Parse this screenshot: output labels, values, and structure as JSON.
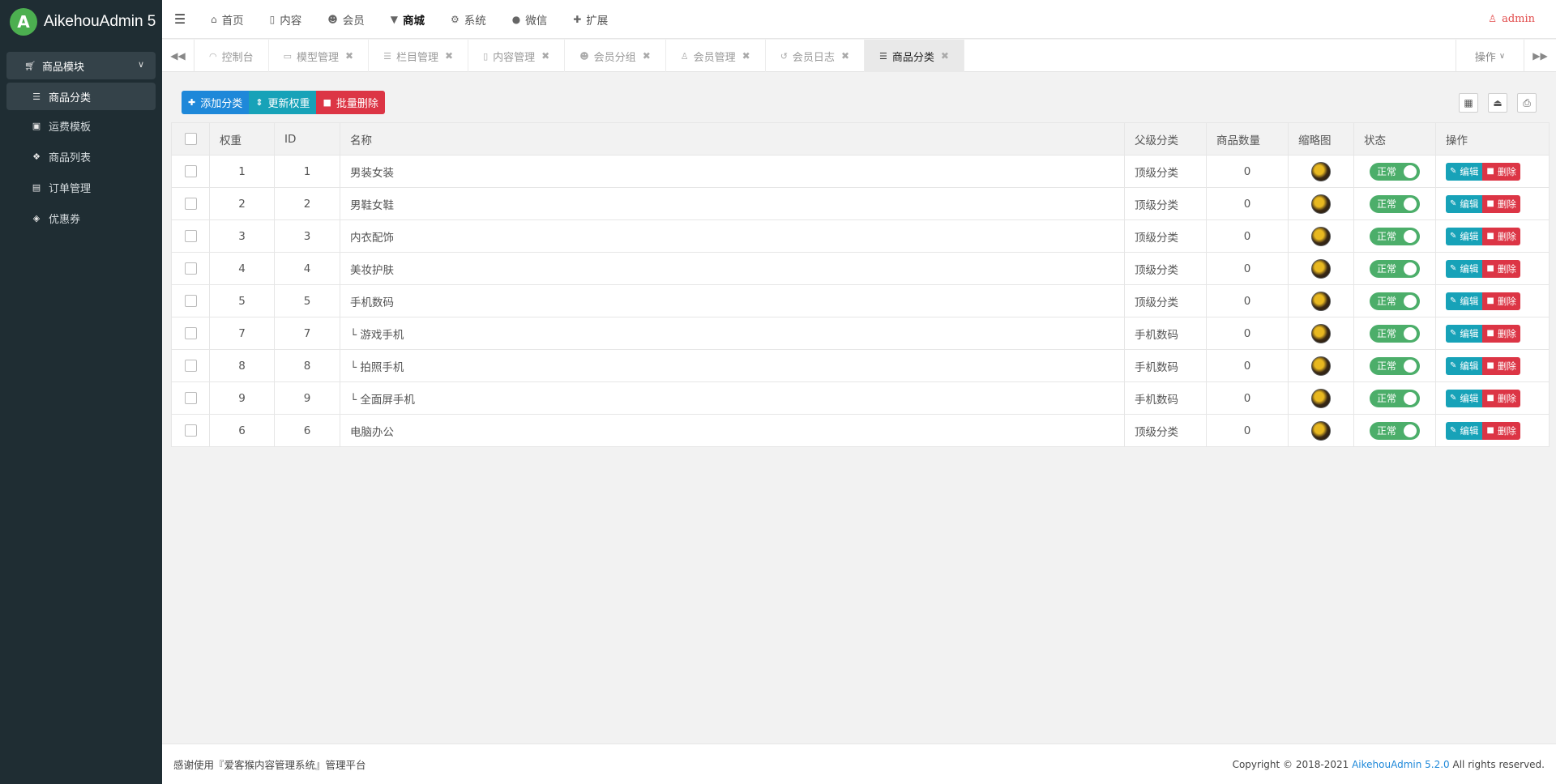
{
  "app": {
    "logo_letter": "A",
    "brand": "AikehouAdmin 5"
  },
  "sidebar": {
    "group_label": "商品模块",
    "items": [
      {
        "label": "商品分类",
        "icon": "list-icon"
      },
      {
        "label": "运费模板",
        "icon": "money-icon"
      },
      {
        "label": "商品列表",
        "icon": "gift-icon"
      },
      {
        "label": "订单管理",
        "icon": "order-icon"
      },
      {
        "label": "优惠券",
        "icon": "ticket-icon"
      }
    ]
  },
  "topnav": {
    "items": [
      {
        "label": "首页",
        "icon": "home-icon"
      },
      {
        "label": "内容",
        "icon": "file-icon"
      },
      {
        "label": "会员",
        "icon": "users-icon"
      },
      {
        "label": "商城",
        "icon": "cart-icon"
      },
      {
        "label": "系统",
        "icon": "gears-icon"
      },
      {
        "label": "微信",
        "icon": "wechat-icon"
      },
      {
        "label": "扩展",
        "icon": "plus-icon"
      }
    ],
    "user": "admin"
  },
  "tabs": {
    "items": [
      {
        "label": "控制台",
        "closable": false
      },
      {
        "label": "模型管理",
        "closable": true
      },
      {
        "label": "栏目管理",
        "closable": true
      },
      {
        "label": "内容管理",
        "closable": true
      },
      {
        "label": "会员分组",
        "closable": true
      },
      {
        "label": "会员管理",
        "closable": true
      },
      {
        "label": "会员日志",
        "closable": true
      },
      {
        "label": "商品分类",
        "closable": true
      }
    ],
    "ops_label": "操作"
  },
  "toolbar": {
    "add_label": "添加分类",
    "update_weight_label": "更新权重",
    "batch_delete_label": "批量删除"
  },
  "table": {
    "headers": [
      "权重",
      "ID",
      "名称",
      "父级分类",
      "商品数量",
      "缩略图",
      "状态",
      "操作"
    ],
    "rows": [
      {
        "weight": "1",
        "id": "1",
        "name": "男装女装",
        "parent": "顶级分类",
        "count": "0",
        "status": "正常"
      },
      {
        "weight": "2",
        "id": "2",
        "name": "男鞋女鞋",
        "parent": "顶级分类",
        "count": "0",
        "status": "正常"
      },
      {
        "weight": "3",
        "id": "3",
        "name": "内衣配饰",
        "parent": "顶级分类",
        "count": "0",
        "status": "正常"
      },
      {
        "weight": "4",
        "id": "4",
        "name": "美妆护肤",
        "parent": "顶级分类",
        "count": "0",
        "status": "正常"
      },
      {
        "weight": "5",
        "id": "5",
        "name": "手机数码",
        "parent": "顶级分类",
        "count": "0",
        "status": "正常"
      },
      {
        "weight": "7",
        "id": "7",
        "name": "└ 游戏手机",
        "parent": "手机数码",
        "count": "0",
        "status": "正常"
      },
      {
        "weight": "8",
        "id": "8",
        "name": "└ 拍照手机",
        "parent": "手机数码",
        "count": "0",
        "status": "正常"
      },
      {
        "weight": "9",
        "id": "9",
        "name": "└ 全面屏手机",
        "parent": "手机数码",
        "count": "0",
        "status": "正常"
      },
      {
        "weight": "6",
        "id": "6",
        "name": "电脑办公",
        "parent": "顶级分类",
        "count": "0",
        "status": "正常"
      }
    ],
    "edit_label": "编辑",
    "delete_label": "删除"
  },
  "footer": {
    "left": "感谢使用『爱客猴内容管理系统』管理平台",
    "copyright_prefix": "Copyright © 2018-2021",
    "copyright_link": "AikehouAdmin 5.2.0",
    "copyright_suffix": "All rights reserved."
  },
  "colors": {
    "sidebar_bg": "#1f2d33",
    "primary": "#1e88d9",
    "info": "#17a2b8",
    "danger": "#dc3545",
    "success": "#4cae6a",
    "admin_text": "#e24c4c"
  }
}
